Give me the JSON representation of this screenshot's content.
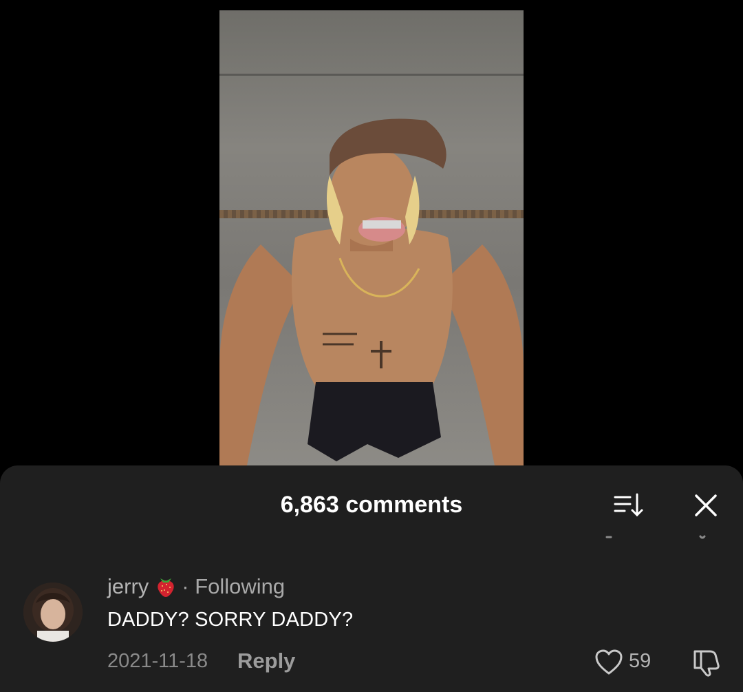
{
  "video": {
    "description_icon": "video-frame"
  },
  "comments_sheet": {
    "title": "6,863 comments",
    "sort_icon": "sort-icon",
    "close_icon": "close-icon"
  },
  "comment": {
    "username": "jerry",
    "badge_icon": "strawberry-icon",
    "relation": "· Following",
    "text": "DADDY? SORRY DADDY?",
    "date": "2021-11-18",
    "reply_label": "Reply",
    "like_count": "59",
    "like_icon": "heart-icon",
    "dislike_icon": "thumbs-down-icon"
  },
  "colors": {
    "background": "#000000",
    "sheet": "#1f1f1f",
    "muted_text": "#8a8a8a",
    "strawberry": "#d3232f"
  }
}
